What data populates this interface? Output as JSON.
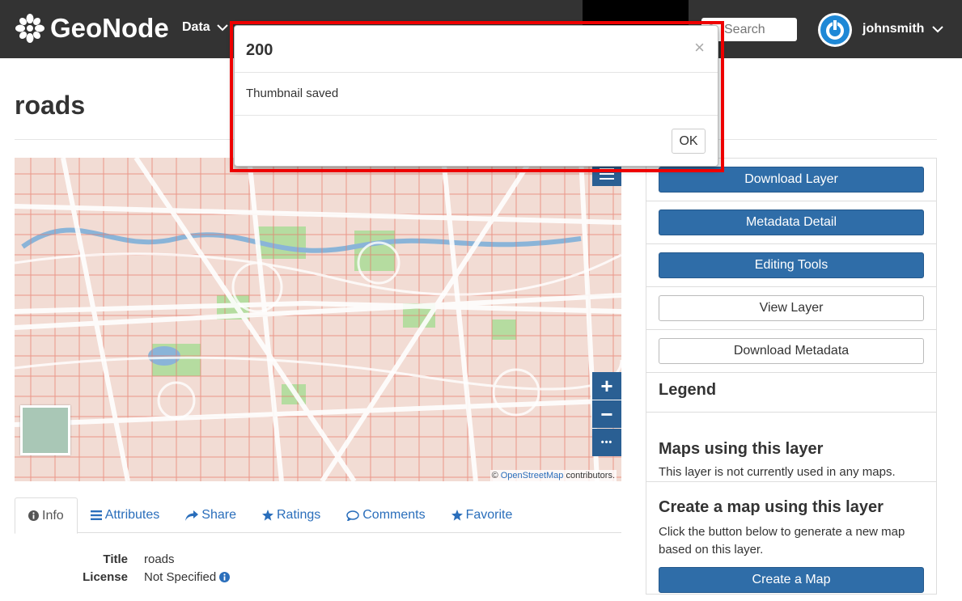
{
  "navbar": {
    "brand": "GeoNode",
    "data_menu": "Data",
    "search_placeholder": "Search",
    "username": "johnsmith",
    "bg_color": "#333333"
  },
  "page": {
    "title": "roads"
  },
  "map": {
    "attribution_prefix": "©",
    "attribution_link": "OpenStreetMap",
    "attribution_suffix": "contributors.",
    "zoom_in": "+",
    "zoom_out": "−",
    "more": "•••",
    "layers_icon": "menu-icon"
  },
  "tabs": [
    {
      "label": "Info",
      "icon": "info-circle-icon"
    },
    {
      "label": "Attributes",
      "icon": "list-icon"
    },
    {
      "label": "Share",
      "icon": "share-icon"
    },
    {
      "label": "Ratings",
      "icon": "star-icon"
    },
    {
      "label": "Comments",
      "icon": "comment-icon"
    },
    {
      "label": "Favorite",
      "icon": "star-icon"
    }
  ],
  "info": [
    {
      "key": "Title",
      "value": "roads"
    },
    {
      "key": "License",
      "value": "Not Specified"
    }
  ],
  "sidebar": {
    "buttons": {
      "download_layer": "Download Layer",
      "metadata_detail": "Metadata Detail",
      "editing_tools": "Editing Tools",
      "view_layer": "View Layer",
      "download_metadata": "Download Metadata"
    },
    "legend_heading": "Legend",
    "maps_heading": "Maps using this layer",
    "maps_text": "This layer is not currently used in any maps.",
    "create_heading": "Create a map using this layer",
    "create_text": "Click the button below to generate a new map based on this layer.",
    "create_button": "Create a Map",
    "primary_color": "#2f6da8"
  },
  "modal": {
    "title": "200",
    "body": "Thumbnail saved",
    "ok": "OK",
    "close": "×",
    "highlight_color": "#ee0000"
  }
}
